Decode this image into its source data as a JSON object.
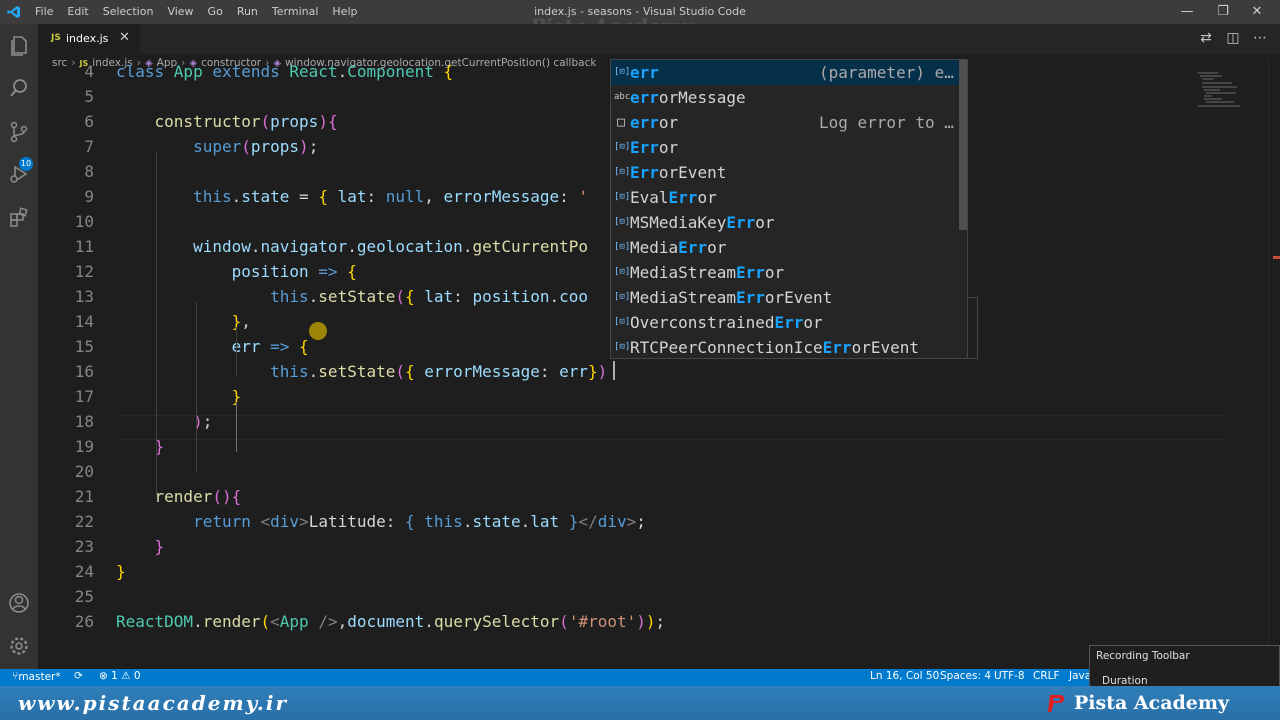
{
  "window": {
    "title": "index.js - seasons - Visual Studio Code",
    "watermark": "Pista Academy",
    "menu": [
      "File",
      "Edit",
      "Selection",
      "View",
      "Go",
      "Run",
      "Terminal",
      "Help"
    ],
    "controls": [
      "—",
      "❐",
      "✕"
    ]
  },
  "activity": {
    "icons": [
      "files-icon",
      "search-icon",
      "source-control-icon",
      "run-debug-icon",
      "extensions-icon",
      "account-icon",
      "settings-gear-icon"
    ],
    "scm_badge": "10"
  },
  "tab": {
    "icon": "JS",
    "name": "index.js",
    "close": "✕"
  },
  "breadcrumb": {
    "src": "src",
    "file": "index.js",
    "cls": "App",
    "method": "constructor",
    "callback": "window.navigator.geolocation.getCurrentPosition() callback"
  },
  "editor": {
    "lines": [
      {
        "n": "4",
        "tokens": [
          [
            "kw",
            "class "
          ],
          [
            "cls",
            "App "
          ],
          [
            "kw",
            "extends "
          ],
          [
            "cls",
            "React"
          ],
          [
            "pun",
            "."
          ],
          [
            "cls",
            "Component "
          ],
          [
            "br",
            "{"
          ]
        ]
      },
      {
        "n": "5",
        "tokens": []
      },
      {
        "n": "6",
        "tokens": [
          [
            "pun",
            "    "
          ],
          [
            "fn",
            "constructor"
          ],
          [
            "br2",
            "("
          ],
          [
            "var",
            "props"
          ],
          [
            "br2",
            "){"
          ]
        ]
      },
      {
        "n": "7",
        "tokens": [
          [
            "pun",
            "        "
          ],
          [
            "kw",
            "super"
          ],
          [
            "br2",
            "("
          ],
          [
            "var",
            "props"
          ],
          [
            "br2",
            ")"
          ],
          [
            "pun",
            ";"
          ]
        ]
      },
      {
        "n": "8",
        "tokens": []
      },
      {
        "n": "9",
        "tokens": [
          [
            "pun",
            "        "
          ],
          [
            "kw",
            "this"
          ],
          [
            "pun",
            "."
          ],
          [
            "var",
            "state"
          ],
          [
            "pun",
            " = "
          ],
          [
            "br",
            "{ "
          ],
          [
            "var",
            "lat"
          ],
          [
            "pun",
            ": "
          ],
          [
            "kw",
            "null"
          ],
          [
            "pun",
            ", "
          ],
          [
            "var",
            "errorMessage"
          ],
          [
            "pun",
            ": "
          ],
          [
            "str",
            "'"
          ]
        ]
      },
      {
        "n": "10",
        "tokens": []
      },
      {
        "n": "11",
        "tokens": [
          [
            "pun",
            "        "
          ],
          [
            "var",
            "window"
          ],
          [
            "pun",
            "."
          ],
          [
            "var",
            "navigator"
          ],
          [
            "pun",
            "."
          ],
          [
            "var",
            "geolocation"
          ],
          [
            "pun",
            "."
          ],
          [
            "fn",
            "getCurrentPo"
          ]
        ]
      },
      {
        "n": "12",
        "tokens": [
          [
            "pun",
            "            "
          ],
          [
            "var",
            "position"
          ],
          [
            "pun",
            " "
          ],
          [
            "kw",
            "=>"
          ],
          [
            "pun",
            " "
          ],
          [
            "br",
            "{"
          ]
        ]
      },
      {
        "n": "13",
        "tokens": [
          [
            "pun",
            "                "
          ],
          [
            "kw",
            "this"
          ],
          [
            "pun",
            "."
          ],
          [
            "fn",
            "setState"
          ],
          [
            "br2",
            "("
          ],
          [
            "br",
            "{ "
          ],
          [
            "var",
            "lat"
          ],
          [
            "pun",
            ": "
          ],
          [
            "var",
            "position"
          ],
          [
            "pun",
            "."
          ],
          [
            "var",
            "coo"
          ]
        ]
      },
      {
        "n": "14",
        "tokens": [
          [
            "pun",
            "            "
          ],
          [
            "br",
            "}"
          ],
          [
            "pun",
            ","
          ]
        ]
      },
      {
        "n": "15",
        "tokens": [
          [
            "pun",
            "            "
          ],
          [
            "var",
            "err"
          ],
          [
            "pun",
            " "
          ],
          [
            "kw",
            "=>"
          ],
          [
            "pun",
            " "
          ],
          [
            "br",
            "{"
          ]
        ]
      },
      {
        "n": "16",
        "tokens": [
          [
            "pun",
            "                "
          ],
          [
            "kw",
            "this"
          ],
          [
            "pun",
            "."
          ],
          [
            "fn",
            "setState"
          ],
          [
            "br2",
            "("
          ],
          [
            "br",
            "{ "
          ],
          [
            "var",
            "errorMessage"
          ],
          [
            "pun",
            ": "
          ],
          [
            "var",
            "err"
          ],
          [
            "br",
            "}"
          ],
          [
            "br2",
            ")"
          ]
        ]
      },
      {
        "n": "17",
        "tokens": [
          [
            "pun",
            "            "
          ],
          [
            "br",
            "}"
          ]
        ]
      },
      {
        "n": "18",
        "tokens": [
          [
            "pun",
            "        "
          ],
          [
            "br2",
            ")"
          ],
          [
            "pun",
            ";"
          ]
        ]
      },
      {
        "n": "19",
        "tokens": [
          [
            "pun",
            "    "
          ],
          [
            "br2",
            "}"
          ]
        ]
      },
      {
        "n": "20",
        "tokens": []
      },
      {
        "n": "21",
        "tokens": [
          [
            "pun",
            "    "
          ],
          [
            "fn",
            "render"
          ],
          [
            "br2",
            "(){"
          ]
        ]
      },
      {
        "n": "22",
        "tokens": [
          [
            "pun",
            "        "
          ],
          [
            "kw",
            "return "
          ],
          [
            "tag",
            "<"
          ],
          [
            "kw",
            "div"
          ],
          [
            "tag",
            ">"
          ],
          [
            "pun",
            "Latitude: "
          ],
          [
            "kw",
            "{ "
          ],
          [
            "kw",
            "this"
          ],
          [
            "pun",
            "."
          ],
          [
            "var",
            "state"
          ],
          [
            "pun",
            "."
          ],
          [
            "var",
            "lat"
          ],
          [
            "kw",
            " }"
          ],
          [
            "tag",
            "</"
          ],
          [
            "kw",
            "div"
          ],
          [
            "tag",
            ">"
          ],
          [
            "pun",
            ";"
          ]
        ]
      },
      {
        "n": "23",
        "tokens": [
          [
            "pun",
            "    "
          ],
          [
            "br2",
            "}"
          ]
        ]
      },
      {
        "n": "24",
        "tokens": [
          [
            "br",
            "}"
          ]
        ]
      },
      {
        "n": "25",
        "tokens": []
      },
      {
        "n": "26",
        "tokens": [
          [
            "cls",
            "ReactDOM"
          ],
          [
            "pun",
            "."
          ],
          [
            "fn",
            "render"
          ],
          [
            "br",
            "("
          ],
          [
            "tag",
            "<"
          ],
          [
            "cls",
            "App"
          ],
          [
            "pun",
            " "
          ],
          [
            "tag",
            "/>"
          ],
          [
            "pun",
            ","
          ],
          [
            "var",
            "document"
          ],
          [
            "pun",
            "."
          ],
          [
            "fn",
            "querySelector"
          ],
          [
            "br2",
            "("
          ],
          [
            "str",
            "'#root'"
          ],
          [
            "br2",
            ")"
          ],
          [
            "br",
            ")"
          ],
          [
            "pun",
            ";"
          ]
        ]
      }
    ]
  },
  "suggestions": [
    {
      "icon": "[⊡]",
      "pre": "",
      "hl": "err",
      "post": "",
      "detail": "(parameter) e…",
      "selected": true
    },
    {
      "icon": "abc",
      "pre": "",
      "hl": "err",
      "post": "orMessage",
      "detail": ""
    },
    {
      "icon": "□",
      "pre": "",
      "hl": "err",
      "post": "or",
      "detail": "Log error to …"
    },
    {
      "icon": "[⊡]",
      "pre": "",
      "hl": "Err",
      "post": "or",
      "detail": ""
    },
    {
      "icon": "[⊡]",
      "pre": "",
      "hl": "Err",
      "post": "orEvent",
      "detail": ""
    },
    {
      "icon": "[⊡]",
      "pre": "Eval",
      "hl": "Err",
      "post": "or",
      "detail": ""
    },
    {
      "icon": "[⊡]",
      "pre": "MSMediaKey",
      "hl": "Err",
      "post": "or",
      "detail": ""
    },
    {
      "icon": "[⊡]",
      "pre": "Media",
      "hl": "Err",
      "post": "or",
      "detail": ""
    },
    {
      "icon": "[⊡]",
      "pre": "MediaStream",
      "hl": "Err",
      "post": "or",
      "detail": ""
    },
    {
      "icon": "[⊡]",
      "pre": "MediaStream",
      "hl": "Err",
      "post": "orEvent",
      "detail": ""
    },
    {
      "icon": "[⊡]",
      "pre": "Overconstrained",
      "hl": "Err",
      "post": "or",
      "detail": ""
    },
    {
      "icon": "[⊡]",
      "pre": "RTCPeerConnectionIce",
      "hl": "Err",
      "post": "orEvent",
      "detail": ""
    }
  ],
  "status": {
    "branch": "master*",
    "sync": "⟳",
    "problems": "⊗ 1 ⚠ 0",
    "position": "Ln 16, Col 50",
    "spaces": "Spaces: 4",
    "encoding": "UTF-8",
    "eol": "CRLF",
    "lang": "Java"
  },
  "recording": {
    "title": "Recording Toolbar",
    "duration": "Duration"
  },
  "watermark": {
    "site": "www.pistaacademy.ir",
    "brand": "Pista Academy"
  }
}
